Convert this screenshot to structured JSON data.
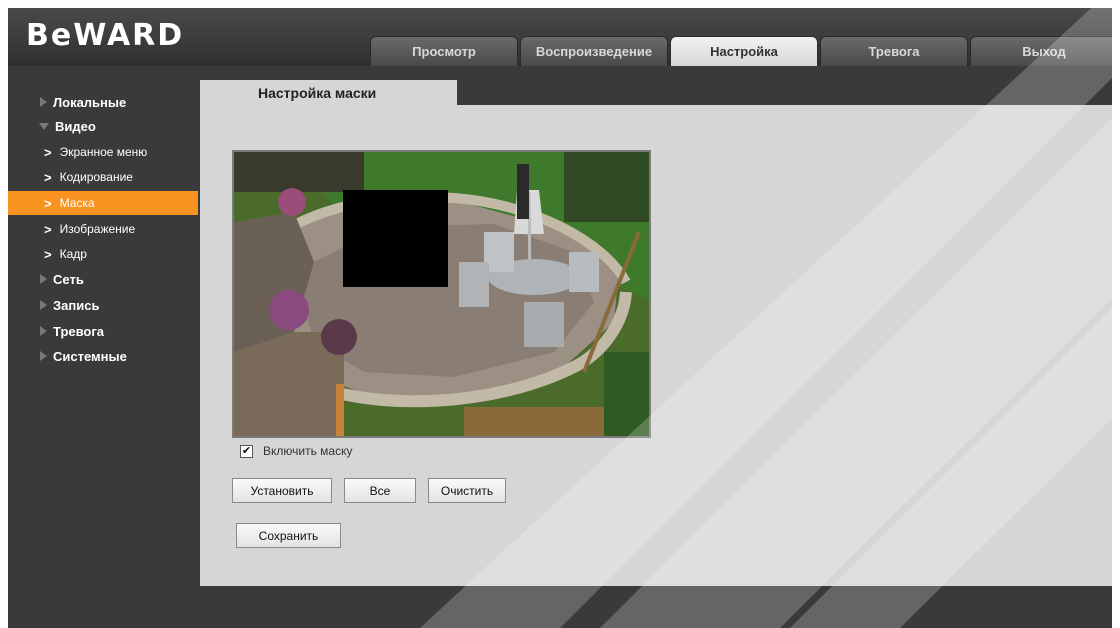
{
  "header": {
    "logo": "BeWARD"
  },
  "tabs": [
    {
      "label": "Просмотр",
      "active": false
    },
    {
      "label": "Воспроизведение",
      "active": false
    },
    {
      "label": "Настройка",
      "active": true
    },
    {
      "label": "Тревога",
      "active": false
    },
    {
      "label": "Выход",
      "active": false
    }
  ],
  "sidebar": {
    "items": [
      {
        "label": "Локальные"
      },
      {
        "label": "Видео",
        "expanded": true
      },
      {
        "label": "Сеть"
      },
      {
        "label": "Запись"
      },
      {
        "label": "Тревога"
      },
      {
        "label": "Системные"
      }
    ],
    "sub_items": [
      {
        "label": "Экранное меню"
      },
      {
        "label": "Кодирование"
      },
      {
        "label": "Маска",
        "active": true
      },
      {
        "label": "Изображение"
      },
      {
        "label": "Кадр"
      }
    ]
  },
  "content": {
    "tab_title": "Настройка маски",
    "enable_mask": {
      "label": "Включить маску",
      "checked": true,
      "mark": "✔"
    },
    "buttons": {
      "set": "Установить",
      "all": "Все",
      "clear": "Очистить",
      "save": "Сохранить"
    }
  },
  "colors": {
    "accent": "#f7931e",
    "content_bg": "#d6d6d6",
    "frame_bg": "#3a3a3a"
  }
}
